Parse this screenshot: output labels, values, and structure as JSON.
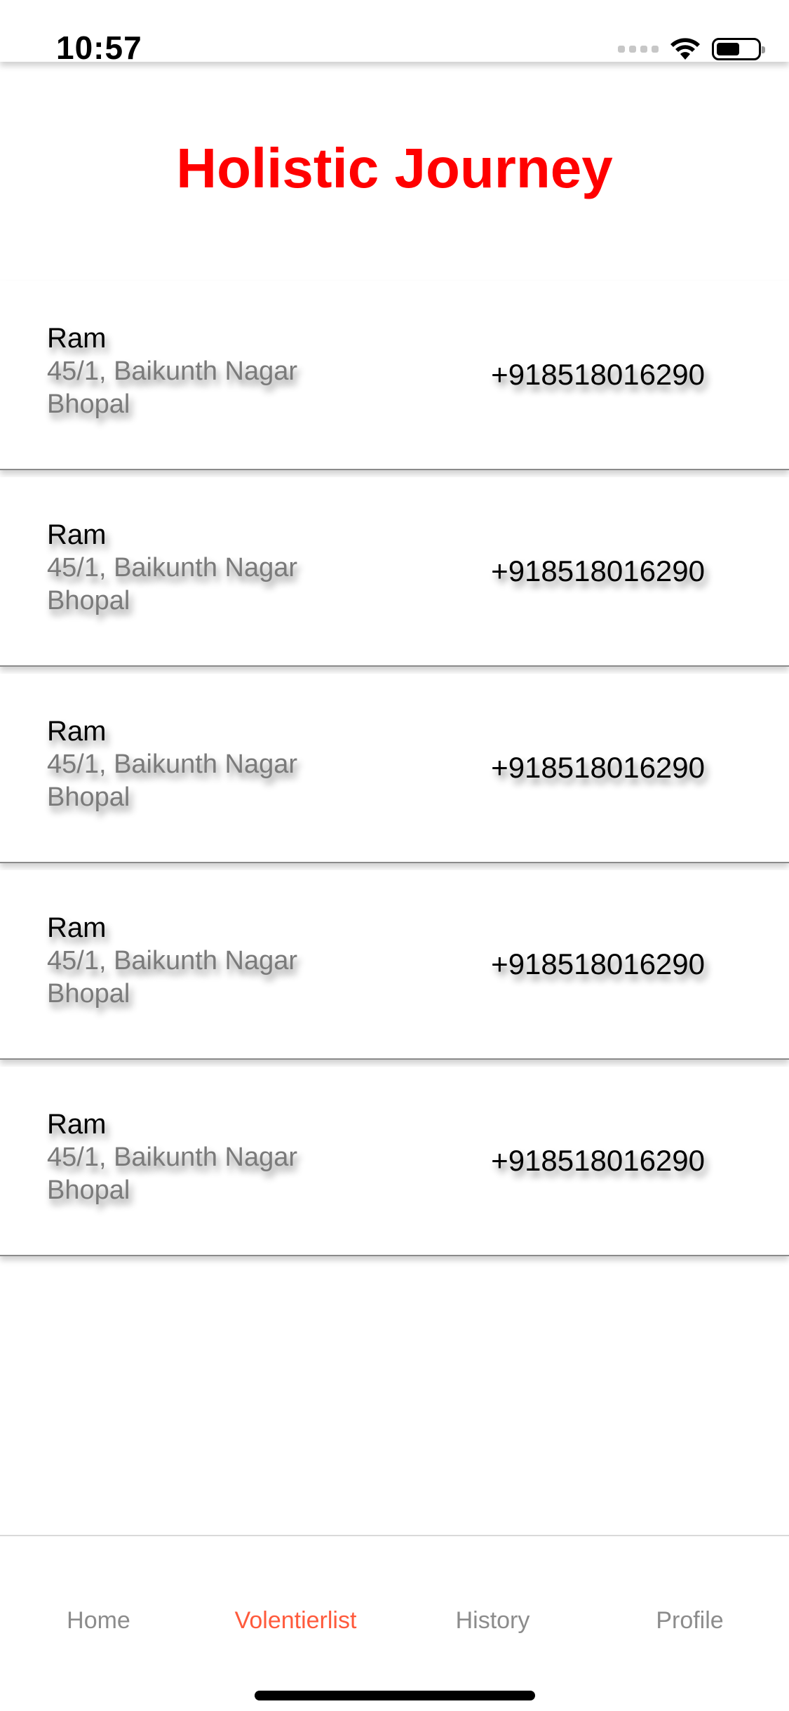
{
  "status_bar": {
    "time": "10:57",
    "icons": [
      "signal-dots-icon",
      "wifi-icon",
      "battery-icon"
    ]
  },
  "header": {
    "title": "Holistic Journey",
    "title_color": "#ff0000"
  },
  "volunteers": [
    {
      "name": "Ram",
      "address": "45/1, Baikunth Nagar\nBhopal",
      "phone": "+918518016290"
    },
    {
      "name": "Ram",
      "address": "45/1, Baikunth Nagar\nBhopal",
      "phone": "+918518016290"
    },
    {
      "name": "Ram",
      "address": "45/1, Baikunth Nagar\nBhopal",
      "phone": "+918518016290"
    },
    {
      "name": "Ram",
      "address": "45/1, Baikunth Nagar\nBhopal",
      "phone": "+918518016290"
    },
    {
      "name": "Ram",
      "address": "45/1, Baikunth Nagar\nBhopal",
      "phone": "+918518016290"
    }
  ],
  "tab_bar": {
    "tabs": [
      {
        "label": "Home",
        "active": false
      },
      {
        "label": "Volentierlist",
        "active": true
      },
      {
        "label": "History",
        "active": false
      },
      {
        "label": "Profile",
        "active": false
      }
    ],
    "active_color": "#ff5a3c",
    "inactive_color": "#8c8c8c"
  }
}
